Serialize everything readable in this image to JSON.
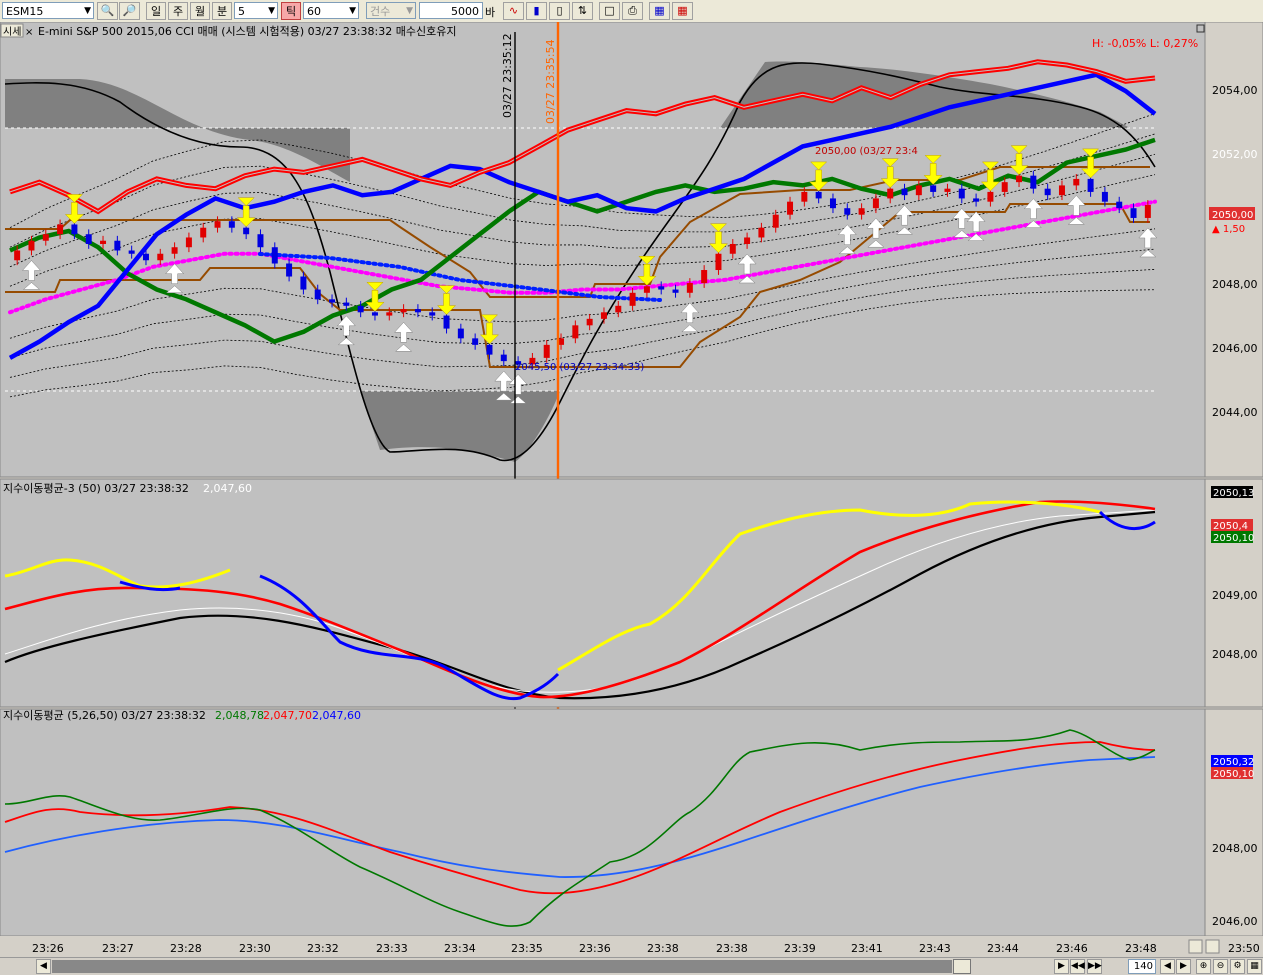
{
  "toolbar": {
    "symbol": "ESM15",
    "period_day": "일",
    "period_week": "주",
    "period_month": "월",
    "period_minute": "분",
    "minute_value": "5",
    "tick_label": "틱",
    "tick_value": "60",
    "count_label": "건수",
    "bars_value": "5000",
    "bars_unit": "바"
  },
  "panel1": {
    "tag": "시세",
    "close_glyph": "×",
    "title": "E-mini S&P 500 2015,06 CCI 매매 (시스템 시험적용) 03/27 23:38:32 매수신호유지",
    "hl_text": "H: -0,05%   L: 0,27%",
    "price_tag": "2050,00",
    "price_change": "▲ 1,50",
    "high_annot": "2050,00 (03/27 23:4",
    "low_annot": "2045,50 (03/27 23:34:33)",
    "vline1_label": "03/27 23:35:12",
    "vline2_label": "03/27 23:35:54",
    "yticks": [
      "2054,00",
      "2052,00",
      "2050,00",
      "2048,00",
      "2046,00",
      "2044,00"
    ]
  },
  "panel2": {
    "title": "지수이동평균-3  (50) 03/27 23:38:32",
    "value": "2,047,60",
    "tags": [
      "2050,13",
      "2050,4",
      "2050,10"
    ],
    "yticks": [
      "2050,00",
      "2049,00",
      "2048,00"
    ]
  },
  "panel3": {
    "title": "지수이동평균  (5,26,50) 03/27 23:38:32",
    "v1": "2,048,78",
    "v2": "2,047,70",
    "v3": "2,047,60",
    "tags": [
      "2050,32",
      "2050,10"
    ],
    "yticks": [
      "2048,00",
      "2046,00"
    ]
  },
  "xaxis": [
    "23:26",
    "23:27",
    "23:28",
    "23:30",
    "23:32",
    "23:33",
    "23:34",
    "23:35",
    "23:36",
    "23:38",
    "23:38",
    "23:39",
    "23:41",
    "23:43",
    "23:44",
    "23:46",
    "23:48"
  ],
  "corner_label": "23:50",
  "scroll": {
    "zoom": "140"
  },
  "colors": {
    "red": "#ff0000",
    "blue": "#0000ff",
    "green": "#007800",
    "brown": "#964b00",
    "magenta": "#ff00ff",
    "yellow": "#ffff00",
    "orange": "#ff6400",
    "bg": "#c0c0c0"
  },
  "chart_data": {
    "type": "candlestick",
    "ylim": [
      2042.6,
      2055.2
    ],
    "candles": [
      {
        "o": 2048.8,
        "c": 2049.1
      },
      {
        "o": 2049.1,
        "c": 2049.4
      },
      {
        "o": 2049.4,
        "c": 2049.6
      },
      {
        "o": 2049.6,
        "c": 2049.9
      },
      {
        "o": 2049.9,
        "c": 2049.6
      },
      {
        "o": 2049.6,
        "c": 2049.3
      },
      {
        "o": 2049.3,
        "c": 2049.4
      },
      {
        "o": 2049.4,
        "c": 2049.1
      },
      {
        "o": 2049.1,
        "c": 2049.0
      },
      {
        "o": 2049.0,
        "c": 2048.8
      },
      {
        "o": 2048.8,
        "c": 2049.0
      },
      {
        "o": 2049.0,
        "c": 2049.2
      },
      {
        "o": 2049.2,
        "c": 2049.5
      },
      {
        "o": 2049.5,
        "c": 2049.8
      },
      {
        "o": 2049.8,
        "c": 2050.0
      },
      {
        "o": 2050.0,
        "c": 2049.8
      },
      {
        "o": 2049.8,
        "c": 2049.6
      },
      {
        "o": 2049.6,
        "c": 2049.2
      },
      {
        "o": 2049.2,
        "c": 2048.7
      },
      {
        "o": 2048.7,
        "c": 2048.3
      },
      {
        "o": 2048.3,
        "c": 2047.9
      },
      {
        "o": 2047.9,
        "c": 2047.6
      },
      {
        "o": 2047.6,
        "c": 2047.5
      },
      {
        "o": 2047.5,
        "c": 2047.4
      },
      {
        "o": 2047.4,
        "c": 2047.2
      },
      {
        "o": 2047.2,
        "c": 2047.1
      },
      {
        "o": 2047.1,
        "c": 2047.2
      },
      {
        "o": 2047.2,
        "c": 2047.3
      },
      {
        "o": 2047.3,
        "c": 2047.2
      },
      {
        "o": 2047.2,
        "c": 2047.1
      },
      {
        "o": 2047.1,
        "c": 2046.7
      },
      {
        "o": 2046.7,
        "c": 2046.4
      },
      {
        "o": 2046.4,
        "c": 2046.2
      },
      {
        "o": 2046.2,
        "c": 2045.9
      },
      {
        "o": 2045.9,
        "c": 2045.7
      },
      {
        "o": 2045.7,
        "c": 2045.6
      },
      {
        "o": 2045.6,
        "c": 2045.8
      },
      {
        "o": 2045.8,
        "c": 2046.2
      },
      {
        "o": 2046.2,
        "c": 2046.4
      },
      {
        "o": 2046.4,
        "c": 2046.8
      },
      {
        "o": 2046.8,
        "c": 2047.0
      },
      {
        "o": 2047.0,
        "c": 2047.2
      },
      {
        "o": 2047.2,
        "c": 2047.4
      },
      {
        "o": 2047.4,
        "c": 2047.8
      },
      {
        "o": 2047.8,
        "c": 2048.0
      },
      {
        "o": 2048.0,
        "c": 2047.9
      },
      {
        "o": 2047.9,
        "c": 2047.8
      },
      {
        "o": 2047.8,
        "c": 2048.1
      },
      {
        "o": 2048.1,
        "c": 2048.5
      },
      {
        "o": 2048.5,
        "c": 2049.0
      },
      {
        "o": 2049.0,
        "c": 2049.3
      },
      {
        "o": 2049.3,
        "c": 2049.5
      },
      {
        "o": 2049.5,
        "c": 2049.8
      },
      {
        "o": 2049.8,
        "c": 2050.2
      },
      {
        "o": 2050.2,
        "c": 2050.6
      },
      {
        "o": 2050.6,
        "c": 2050.9
      },
      {
        "o": 2050.9,
        "c": 2050.7
      },
      {
        "o": 2050.7,
        "c": 2050.4
      },
      {
        "o": 2050.4,
        "c": 2050.2
      },
      {
        "o": 2050.2,
        "c": 2050.4
      },
      {
        "o": 2050.4,
        "c": 2050.7
      },
      {
        "o": 2050.7,
        "c": 2051.0
      },
      {
        "o": 2051.0,
        "c": 2050.8
      },
      {
        "o": 2050.8,
        "c": 2051.1
      },
      {
        "o": 2051.1,
        "c": 2050.9
      },
      {
        "o": 2050.9,
        "c": 2051.0
      },
      {
        "o": 2051.0,
        "c": 2050.7
      },
      {
        "o": 2050.7,
        "c": 2050.6
      },
      {
        "o": 2050.6,
        "c": 2050.9
      },
      {
        "o": 2050.9,
        "c": 2051.2
      },
      {
        "o": 2051.2,
        "c": 2051.4
      },
      {
        "o": 2051.4,
        "c": 2051.0
      },
      {
        "o": 2051.0,
        "c": 2050.8
      },
      {
        "o": 2050.8,
        "c": 2051.1
      },
      {
        "o": 2051.1,
        "c": 2051.3
      },
      {
        "o": 2051.3,
        "c": 2050.9
      },
      {
        "o": 2050.9,
        "c": 2050.6
      },
      {
        "o": 2050.6,
        "c": 2050.4
      },
      {
        "o": 2050.4,
        "c": 2050.1
      },
      {
        "o": 2050.1,
        "c": 2050.5
      }
    ],
    "upper_red": [
      2050.9,
      2051.2,
      2050.8,
      2050.3,
      2050.9,
      2051.3,
      2051.1,
      2051.0,
      2051.4,
      2051.6,
      2051.5,
      2051.7,
      2051.9,
      2051.6,
      2051.3,
      2051.1,
      2051.5,
      2051.8,
      2052.3,
      2052.8,
      2053.1,
      2053.4,
      2053.3,
      2053.6,
      2053.8,
      2053.5,
      2053.7,
      2053.9,
      2053.7,
      2054.1,
      2053.8,
      2054.2,
      2054.5,
      2054.6,
      2054.7,
      2054.9,
      2054.8,
      2054.6,
      2054.3,
      2054.4
    ],
    "upper_blue": [
      2045.8,
      2046.3,
      2046.9,
      2047.4,
      2048.5,
      2049.6,
      2050.2,
      2050.7,
      2050.4,
      2050.6,
      2050.9,
      2051.1,
      2050.8,
      2050.9,
      2051.3,
      2051.7,
      2051.6,
      2051.2,
      2050.9,
      2050.6,
      2050.8,
      2050.4,
      2050.3,
      2050.7,
      2051.0,
      2051.3,
      2051.8,
      2052.3,
      2052.5,
      2052.7,
      2052.9,
      2053.2,
      2053.5,
      2053.7,
      2053.9,
      2054.1,
      2054.3,
      2054.5,
      2054.0,
      2053.3
    ],
    "mid_green": [
      2049.1,
      2049.5,
      2049.7,
      2049.2,
      2048.4,
      2047.9,
      2047.6,
      2047.2,
      2046.8,
      2046.3,
      2046.6,
      2047.1,
      2047.4,
      2047.9,
      2048.2,
      2048.9,
      2049.6,
      2050.3,
      2050.9,
      2050.6,
      2050.3,
      2050.6,
      2050.9,
      2051.1,
      2050.9,
      2051.0,
      2051.2,
      2051.1,
      2051.3,
      2051.0,
      2050.8,
      2051.1,
      2051.3,
      2051.0,
      2051.4,
      2051.2,
      2051.8,
      2052.0,
      2052.2,
      2052.5
    ],
    "magenta": [
      2047.2,
      2047.6,
      2047.9,
      2048.2,
      2048.6,
      2048.8,
      2049.0,
      2049.0,
      2048.8,
      2048.6,
      2048.4,
      2048.2,
      2048.0,
      2047.9,
      2047.8,
      2047.8,
      2047.9,
      2047.9,
      2048.0,
      2048.1,
      2048.2,
      2048.4,
      2048.6,
      2048.8,
      2049.0,
      2049.2,
      2049.4,
      2049.6,
      2049.8,
      2050.0,
      2050.2,
      2050.4,
      2050.6
    ]
  }
}
